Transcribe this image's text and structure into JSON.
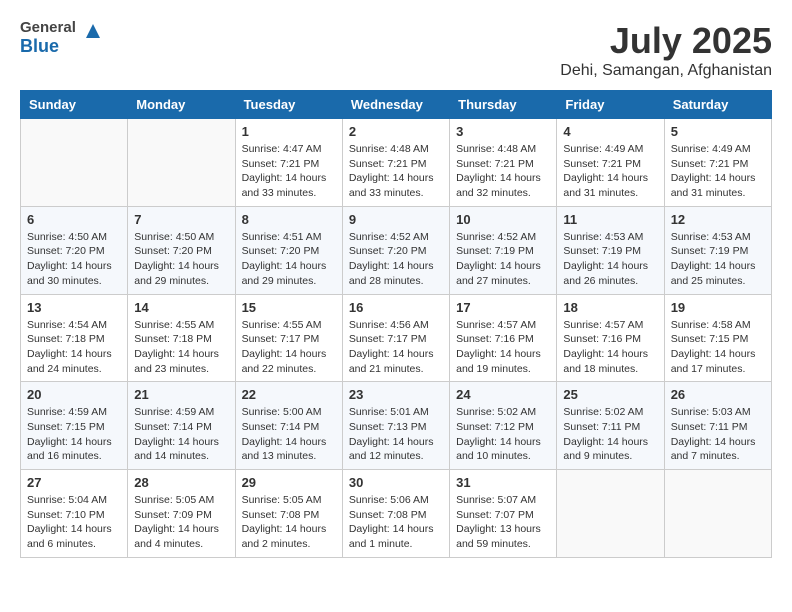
{
  "header": {
    "logo_line1": "General",
    "logo_line2": "Blue",
    "title": "July 2025",
    "subtitle": "Dehi, Samangan, Afghanistan"
  },
  "calendar": {
    "days_of_week": [
      "Sunday",
      "Monday",
      "Tuesday",
      "Wednesday",
      "Thursday",
      "Friday",
      "Saturday"
    ],
    "weeks": [
      [
        {
          "day": "",
          "detail": ""
        },
        {
          "day": "",
          "detail": ""
        },
        {
          "day": "1",
          "detail": "Sunrise: 4:47 AM\nSunset: 7:21 PM\nDaylight: 14 hours and 33 minutes."
        },
        {
          "day": "2",
          "detail": "Sunrise: 4:48 AM\nSunset: 7:21 PM\nDaylight: 14 hours and 33 minutes."
        },
        {
          "day": "3",
          "detail": "Sunrise: 4:48 AM\nSunset: 7:21 PM\nDaylight: 14 hours and 32 minutes."
        },
        {
          "day": "4",
          "detail": "Sunrise: 4:49 AM\nSunset: 7:21 PM\nDaylight: 14 hours and 31 minutes."
        },
        {
          "day": "5",
          "detail": "Sunrise: 4:49 AM\nSunset: 7:21 PM\nDaylight: 14 hours and 31 minutes."
        }
      ],
      [
        {
          "day": "6",
          "detail": "Sunrise: 4:50 AM\nSunset: 7:20 PM\nDaylight: 14 hours and 30 minutes."
        },
        {
          "day": "7",
          "detail": "Sunrise: 4:50 AM\nSunset: 7:20 PM\nDaylight: 14 hours and 29 minutes."
        },
        {
          "day": "8",
          "detail": "Sunrise: 4:51 AM\nSunset: 7:20 PM\nDaylight: 14 hours and 29 minutes."
        },
        {
          "day": "9",
          "detail": "Sunrise: 4:52 AM\nSunset: 7:20 PM\nDaylight: 14 hours and 28 minutes."
        },
        {
          "day": "10",
          "detail": "Sunrise: 4:52 AM\nSunset: 7:19 PM\nDaylight: 14 hours and 27 minutes."
        },
        {
          "day": "11",
          "detail": "Sunrise: 4:53 AM\nSunset: 7:19 PM\nDaylight: 14 hours and 26 minutes."
        },
        {
          "day": "12",
          "detail": "Sunrise: 4:53 AM\nSunset: 7:19 PM\nDaylight: 14 hours and 25 minutes."
        }
      ],
      [
        {
          "day": "13",
          "detail": "Sunrise: 4:54 AM\nSunset: 7:18 PM\nDaylight: 14 hours and 24 minutes."
        },
        {
          "day": "14",
          "detail": "Sunrise: 4:55 AM\nSunset: 7:18 PM\nDaylight: 14 hours and 23 minutes."
        },
        {
          "day": "15",
          "detail": "Sunrise: 4:55 AM\nSunset: 7:17 PM\nDaylight: 14 hours and 22 minutes."
        },
        {
          "day": "16",
          "detail": "Sunrise: 4:56 AM\nSunset: 7:17 PM\nDaylight: 14 hours and 21 minutes."
        },
        {
          "day": "17",
          "detail": "Sunrise: 4:57 AM\nSunset: 7:16 PM\nDaylight: 14 hours and 19 minutes."
        },
        {
          "day": "18",
          "detail": "Sunrise: 4:57 AM\nSunset: 7:16 PM\nDaylight: 14 hours and 18 minutes."
        },
        {
          "day": "19",
          "detail": "Sunrise: 4:58 AM\nSunset: 7:15 PM\nDaylight: 14 hours and 17 minutes."
        }
      ],
      [
        {
          "day": "20",
          "detail": "Sunrise: 4:59 AM\nSunset: 7:15 PM\nDaylight: 14 hours and 16 minutes."
        },
        {
          "day": "21",
          "detail": "Sunrise: 4:59 AM\nSunset: 7:14 PM\nDaylight: 14 hours and 14 minutes."
        },
        {
          "day": "22",
          "detail": "Sunrise: 5:00 AM\nSunset: 7:14 PM\nDaylight: 14 hours and 13 minutes."
        },
        {
          "day": "23",
          "detail": "Sunrise: 5:01 AM\nSunset: 7:13 PM\nDaylight: 14 hours and 12 minutes."
        },
        {
          "day": "24",
          "detail": "Sunrise: 5:02 AM\nSunset: 7:12 PM\nDaylight: 14 hours and 10 minutes."
        },
        {
          "day": "25",
          "detail": "Sunrise: 5:02 AM\nSunset: 7:11 PM\nDaylight: 14 hours and 9 minutes."
        },
        {
          "day": "26",
          "detail": "Sunrise: 5:03 AM\nSunset: 7:11 PM\nDaylight: 14 hours and 7 minutes."
        }
      ],
      [
        {
          "day": "27",
          "detail": "Sunrise: 5:04 AM\nSunset: 7:10 PM\nDaylight: 14 hours and 6 minutes."
        },
        {
          "day": "28",
          "detail": "Sunrise: 5:05 AM\nSunset: 7:09 PM\nDaylight: 14 hours and 4 minutes."
        },
        {
          "day": "29",
          "detail": "Sunrise: 5:05 AM\nSunset: 7:08 PM\nDaylight: 14 hours and 2 minutes."
        },
        {
          "day": "30",
          "detail": "Sunrise: 5:06 AM\nSunset: 7:08 PM\nDaylight: 14 hours and 1 minute."
        },
        {
          "day": "31",
          "detail": "Sunrise: 5:07 AM\nSunset: 7:07 PM\nDaylight: 13 hours and 59 minutes."
        },
        {
          "day": "",
          "detail": ""
        },
        {
          "day": "",
          "detail": ""
        }
      ]
    ]
  }
}
